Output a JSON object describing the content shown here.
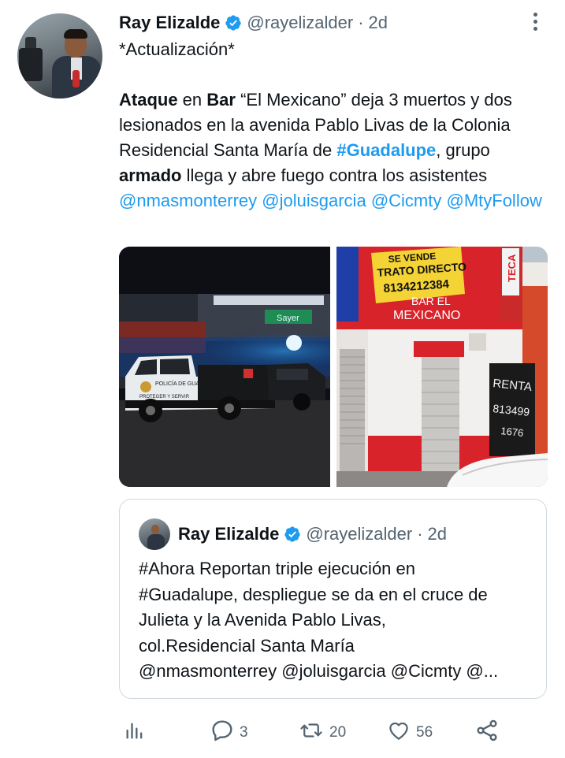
{
  "tweet": {
    "author_name": "Ray Elizalde",
    "handle": "@rayelizalder",
    "separator": "·",
    "time": "2d",
    "line_intro": "*Actualización*",
    "seg_ataque": "Ataque",
    "seg_en": " en ",
    "seg_bar": "Bar",
    "seg_middle": " “El Mexicano” deja 3 muertos y dos lesionados en la avenida Pablo Livas de la Colonia Residencial Santa María de ",
    "seg_hashtag": "#Guadalupe",
    "seg_grupo": ", grupo ",
    "seg_armado": "armado",
    "seg_end": " llega y abre fuego contra los asistentes  ",
    "mention_1": "@nmasmonterrey",
    "mention_2": "@joluisgarcia",
    "mention_3": "@Cicmty",
    "mention_4": "@MtyFollow"
  },
  "media": {
    "photo1_sign": "Sayer",
    "photo1_truck_text": "POLICÍA DE GUADALUPE",
    "photo1_truck_motto": "PROTEGER Y SERVIR",
    "photo2_banner_1": "SE VENDE",
    "photo2_banner_2": "TRATO DIRECTO",
    "photo2_banner_3": "8134212384",
    "photo2_bar_name_1": "BAR EL",
    "photo2_bar_name_2": "MEXICANO",
    "photo2_side_sign": "TECA",
    "photo2_graffiti_1": "RENTA",
    "photo2_graffiti_2": "813499",
    "photo2_graffiti_3": "1676"
  },
  "quoted": {
    "author_name": "Ray Elizalde",
    "handle": "@rayelizalder",
    "separator": "·",
    "time": "2d",
    "lines": [
      "#Ahora Reportan triple ejecución en",
      "#Guadalupe, despliegue se da en el cruce de",
      "Julieta y la Avenida Pablo Livas,",
      "col.Residencial Santa María",
      "@nmasmonterrey @joluisgarcia @Cicmty @..."
    ]
  },
  "actions": {
    "replies": "3",
    "retweets": "20",
    "likes": "56"
  },
  "colors": {
    "link": "#1d9bf0",
    "muted": "#536471",
    "verified": "#1d9bf0"
  },
  "icons": [
    "verified-badge-icon",
    "more-options-icon",
    "analytics-icon",
    "reply-icon",
    "retweet-icon",
    "like-icon",
    "share-icon"
  ]
}
